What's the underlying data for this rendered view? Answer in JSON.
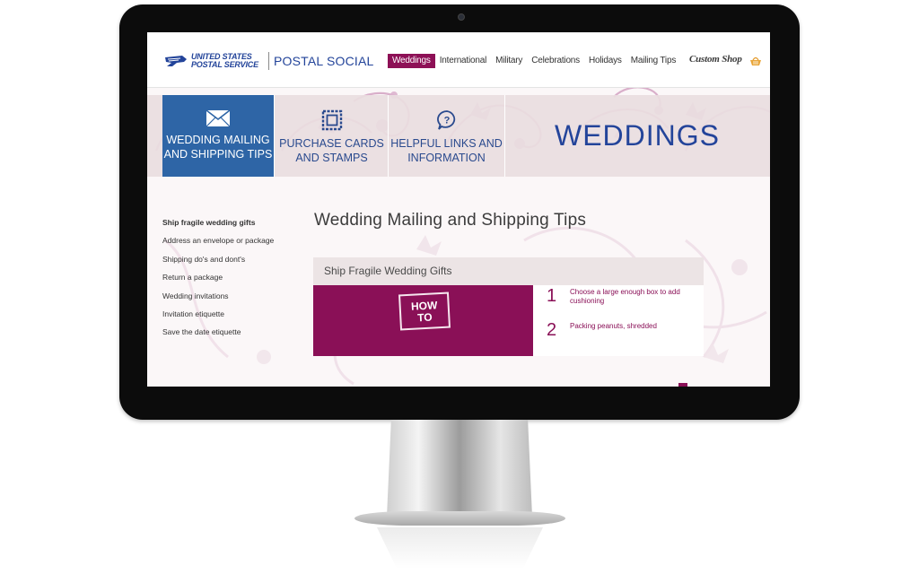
{
  "header": {
    "logo_line1": "UNITED STATES",
    "logo_line2": "POSTAL SERVICE",
    "brand": "POSTAL SOCIAL",
    "nav": [
      {
        "label": "Weddings",
        "active": true
      },
      {
        "label": "International",
        "active": false
      },
      {
        "label": "Military",
        "active": false
      },
      {
        "label": "Celebrations",
        "active": false
      },
      {
        "label": "Holidays",
        "active": false
      },
      {
        "label": "Mailing Tips",
        "active": false
      }
    ],
    "custom_shop": "Custom Shop",
    "basket_icon": "basket-icon"
  },
  "tiles": [
    {
      "line1": "WEDDING MAILING",
      "line2": "AND SHIPPING TIPS",
      "icon": "envelope-icon",
      "active": true
    },
    {
      "line1": "PURCHASE CARDS",
      "line2": "AND STAMPS",
      "icon": "stamp-icon",
      "active": false
    },
    {
      "line1": "HELPFUL LINKS AND",
      "line2": "INFORMATION",
      "icon": "question-bubble-icon",
      "active": false
    }
  ],
  "hero_title": "WEDDINGS",
  "sidebar": [
    "Ship fragile wedding gifts",
    "Address an envelope or package",
    "Shipping do's and dont's",
    "Return a package",
    "Wedding invitations",
    "Invitation etiquette",
    "Save the date etiquette"
  ],
  "page_title": "Wedding Mailing and Shipping Tips",
  "section": {
    "title": "Ship Fragile Wedding Gifts",
    "image_text_line1": "HOW",
    "image_text_line2": "TO",
    "steps": [
      {
        "num": "1",
        "text": "Choose a large enough box to add cushioning"
      },
      {
        "num": "2",
        "text": "Packing peanuts, shredded"
      }
    ]
  },
  "colors": {
    "accent_purple": "#8d1056",
    "usps_blue": "#23449a",
    "tile_active": "#2e65a6",
    "band": "#e9dee0"
  }
}
